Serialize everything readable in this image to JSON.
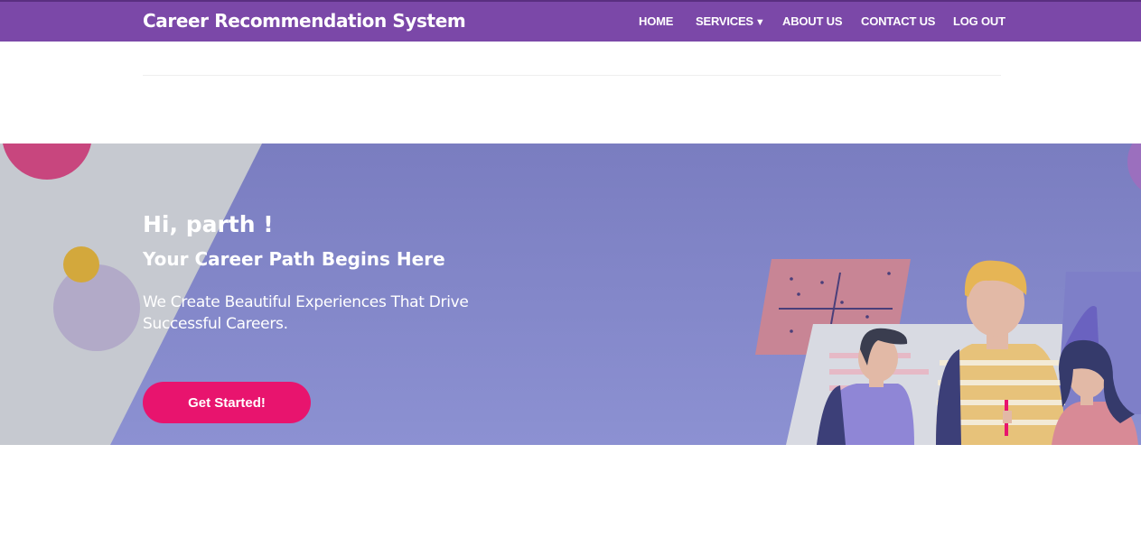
{
  "header": {
    "brand": "Career Recommendation System",
    "nav": {
      "home": "HOME",
      "services": "SERVICES",
      "about": "ABOUT US",
      "contact": "CONTACT US",
      "logout": "LOG OUT"
    },
    "services_caret_icon": "caret-down-icon"
  },
  "hero": {
    "greeting": "Hi, parth !",
    "title": "Your Career Path Begins Here",
    "text": "We Create Beautiful Experiences That Drive Successful Careers.",
    "cta_label": "Get Started!"
  },
  "colors": {
    "nav_bg": "#7b48a8",
    "hero_bg": "#7d80c4",
    "cta": "#e8146e"
  }
}
